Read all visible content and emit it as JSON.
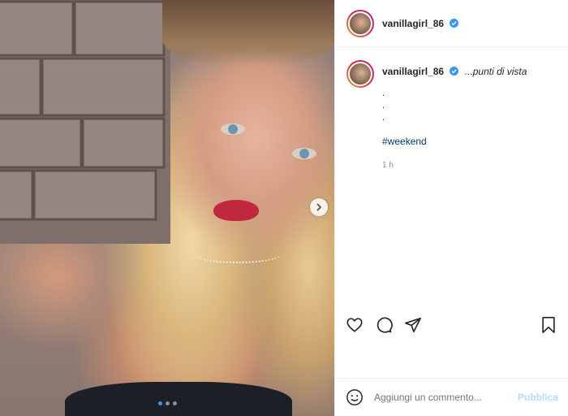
{
  "post": {
    "username": "vanillagirl_86",
    "caption": "...punti di vista",
    "dots": [
      ".",
      ".",
      "."
    ],
    "hashtag": "#weekend",
    "time": "1 h",
    "carousel": {
      "current": 1,
      "total": 3
    }
  },
  "comment_box": {
    "placeholder": "Aggiungi un commento...",
    "publish_label": "Pubblica"
  },
  "icons": {
    "verified": "verified-badge-icon",
    "like": "heart-icon",
    "comment": "comment-bubble-icon",
    "share": "paper-plane-icon",
    "save": "bookmark-icon",
    "emoji": "emoji-icon",
    "next": "chevron-right-icon"
  },
  "colors": {
    "link": "#00376b",
    "verified": "#3897f0",
    "publish_disabled": "#b3dbff",
    "meta": "#8e8e8e"
  }
}
